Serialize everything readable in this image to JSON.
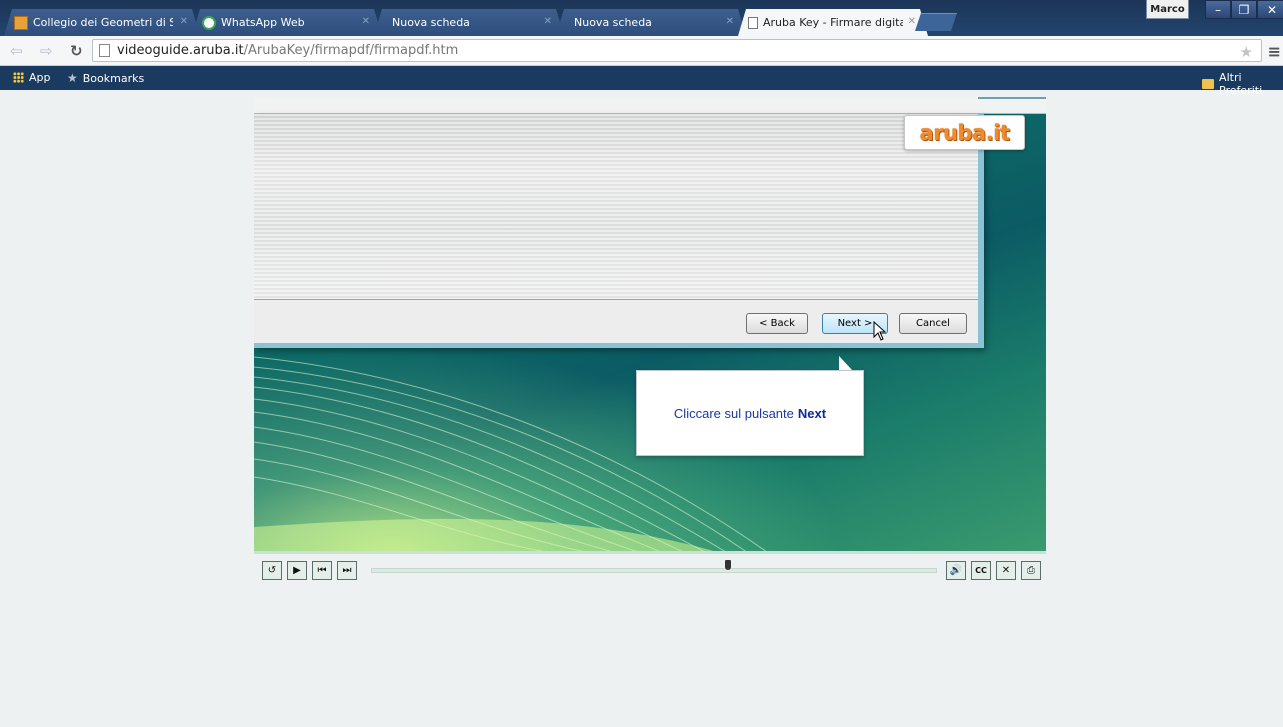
{
  "browser": {
    "tabs": [
      {
        "label": "Collegio dei Geometri di S",
        "favicon": "building-icon",
        "active": false
      },
      {
        "label": "WhatsApp Web",
        "favicon": "whatsapp-icon",
        "active": false
      },
      {
        "label": "Nuova scheda",
        "favicon": "",
        "active": false
      },
      {
        "label": "Nuova scheda",
        "favicon": "",
        "active": false
      },
      {
        "label": "Aruba Key - Firmare digita",
        "favicon": "page-icon",
        "active": true
      }
    ],
    "profile_name": "Marco",
    "url_domain": "videoguide.aruba.it",
    "url_path": "/ArubaKey/firmapdf/firmapdf.htm",
    "bookmarks": [
      {
        "label": "App"
      },
      {
        "label": "Bookmarks"
      }
    ],
    "other_bookmarks": "Altri Preferiti"
  },
  "dialog": {
    "back_label": "< Back",
    "next_label": "Next >",
    "cancel_label": "Cancel"
  },
  "logo_text": "aruba.it",
  "callout": {
    "text": "Cliccare sul pulsante",
    "emphasis": "Next"
  },
  "player": {
    "progress": 0.63,
    "controls": [
      "replay-icon",
      "play-icon",
      "previous-icon",
      "next-icon",
      "volume-icon",
      "captions-icon",
      "close-icon",
      "print-icon"
    ]
  },
  "colors": {
    "chrome_frame": "#1c3558",
    "bookmark_bar": "#1b3a5f",
    "callout_text": "#1a39a3",
    "logo_orange": "#f08a2a"
  }
}
